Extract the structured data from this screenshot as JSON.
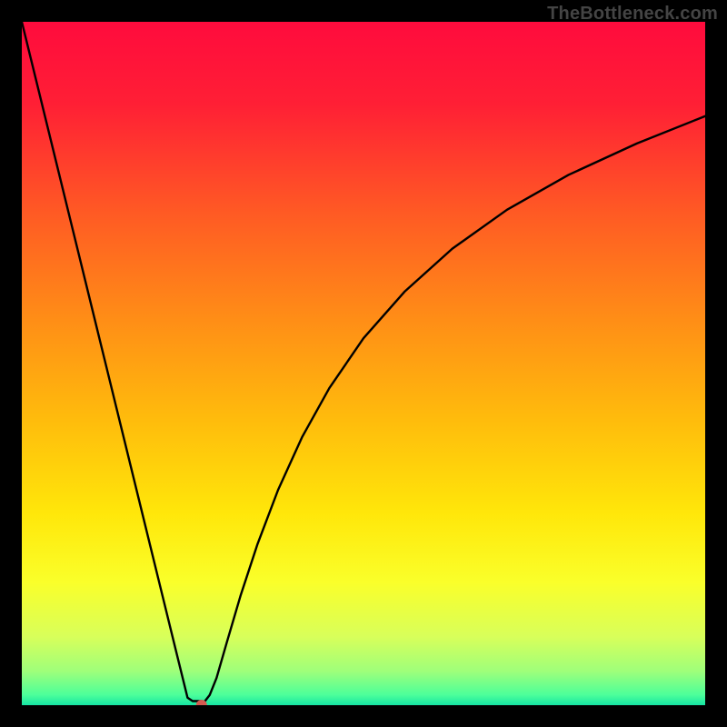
{
  "watermark": "TheBottleneck.com",
  "chart_data": {
    "type": "line",
    "title": "",
    "xlabel": "",
    "ylabel": "",
    "xlim": [
      0,
      100
    ],
    "ylim": [
      0,
      100
    ],
    "gradient_stops": [
      {
        "offset": 0.0,
        "color": "#ff0b3d"
      },
      {
        "offset": 0.12,
        "color": "#ff1f35"
      },
      {
        "offset": 0.28,
        "color": "#ff5a24"
      },
      {
        "offset": 0.44,
        "color": "#ff8f16"
      },
      {
        "offset": 0.58,
        "color": "#ffbb0c"
      },
      {
        "offset": 0.72,
        "color": "#ffe70a"
      },
      {
        "offset": 0.82,
        "color": "#faff2a"
      },
      {
        "offset": 0.9,
        "color": "#d8ff5a"
      },
      {
        "offset": 0.95,
        "color": "#9fff7a"
      },
      {
        "offset": 0.985,
        "color": "#4cff9a"
      },
      {
        "offset": 1.0,
        "color": "#16e4a3"
      }
    ],
    "series": [
      {
        "name": "curve",
        "x": [
          0.0,
          2.5,
          5.0,
          7.5,
          10.0,
          12.5,
          15.0,
          17.5,
          20.0,
          22.5,
          24.25,
          25.0,
          25.5,
          26.3,
          26.3,
          26.8,
          27.5,
          28.5,
          30.0,
          32.0,
          34.5,
          37.5,
          41.0,
          45.0,
          50.0,
          56.0,
          63.0,
          71.0,
          80.0,
          90.0,
          100.0
        ],
        "y": [
          100.0,
          89.8,
          79.6,
          69.4,
          59.2,
          49.0,
          38.8,
          28.6,
          18.4,
          8.2,
          1.1,
          0.6,
          0.6,
          0.6,
          0.0,
          0.6,
          1.5,
          4.0,
          9.2,
          16.0,
          23.6,
          31.5,
          39.2,
          46.4,
          53.7,
          60.5,
          66.8,
          72.5,
          77.6,
          82.2,
          86.2
        ]
      }
    ],
    "marker": {
      "x": 26.3,
      "y": 0.0,
      "color": "#d45a50",
      "r": 6
    }
  }
}
